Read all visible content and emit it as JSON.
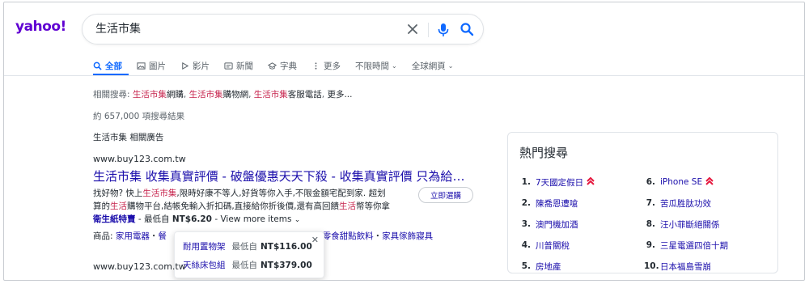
{
  "header": {
    "logo": "yahoo!",
    "search_value": "生活市集"
  },
  "tabs": [
    {
      "label": "全部",
      "icon": "search-icon",
      "active": true
    },
    {
      "label": "圖片",
      "icon": "image-icon"
    },
    {
      "label": "影片",
      "icon": "play-icon"
    },
    {
      "label": "新聞",
      "icon": "news-icon"
    },
    {
      "label": "字典",
      "icon": "dictionary-icon"
    },
    {
      "label": "更多",
      "icon": "more-icon"
    },
    {
      "label": "不限時間",
      "icon": "chevron-down-icon"
    },
    {
      "label": "全球網頁",
      "icon": "chevron-down-icon"
    }
  ],
  "related": {
    "label": "相關搜尋:",
    "items": [
      {
        "hl": "生活市集",
        "rest": "網購"
      },
      {
        "hl": "生活市集",
        "rest": "購物網"
      },
      {
        "hl": "生活市集",
        "rest": "客服電話"
      }
    ],
    "more": "更多..."
  },
  "result_count": "約 657,000 項搜尋結果",
  "ads_label": "生活市集 相關廣告",
  "ad": {
    "url": "www.buy123.com.tw",
    "title": "生活市集 收集真實評價 - 破盤優惠天天下殺 - 收集真實評價 只為給你...",
    "desc_1a": "找好物? 快上",
    "desc_1b": "生活市集",
    "desc_1c": ",限時好康不等人,好貨等你入手,不限金額宅配到家. 超划",
    "desc_2a": "算的",
    "desc_2b": "生活",
    "desc_2c": "購物平台,結帳免輸入折扣碼,直接給你折後價,還有高回饋",
    "desc_2d": "生活",
    "desc_2e": "幣等你拿",
    "link": "衛生紙特賣",
    "price_prefix": " - 最低自 ",
    "price": "NT$6.20",
    "view_more": " - View more items",
    "cta": "立即選購",
    "goods_label": "商品:",
    "goods_1": "家用電器",
    "goods_2": "餐",
    "goods_tail": "零食甜點飲料",
    "goods_last": "家具傢飾寢具"
  },
  "popup": {
    "items": [
      {
        "name": "耐用置物架",
        "prefix": "最低自",
        "price": "NT$116.00"
      },
      {
        "name": "天絲床包組",
        "prefix": "最低自",
        "price": "NT$379.00"
      }
    ]
  },
  "result2_url": "www.buy123.com.tw",
  "trending": {
    "title": "熱門搜尋",
    "left": [
      {
        "n": "1.",
        "t": "7天國定假日",
        "hot": true
      },
      {
        "n": "2.",
        "t": "陳喬恩遭嗆"
      },
      {
        "n": "3.",
        "t": "澳門機加酒"
      },
      {
        "n": "4.",
        "t": "川普關稅"
      },
      {
        "n": "5.",
        "t": "房地產"
      }
    ],
    "right": [
      {
        "n": "6.",
        "t": "iPhone SE",
        "hot": true
      },
      {
        "n": "7.",
        "t": "苦瓜胜肽功效"
      },
      {
        "n": "8.",
        "t": "汪小菲斷絕關係"
      },
      {
        "n": "9.",
        "t": "三星電選四倍十期"
      },
      {
        "n": "10.",
        "t": "日本福島雪崩"
      }
    ]
  },
  "colors": {
    "brand": "#6001d2",
    "accent": "#0f69ff",
    "link": "#1a0dab",
    "highlight": "#c7254e",
    "hot": "#e5173d"
  }
}
